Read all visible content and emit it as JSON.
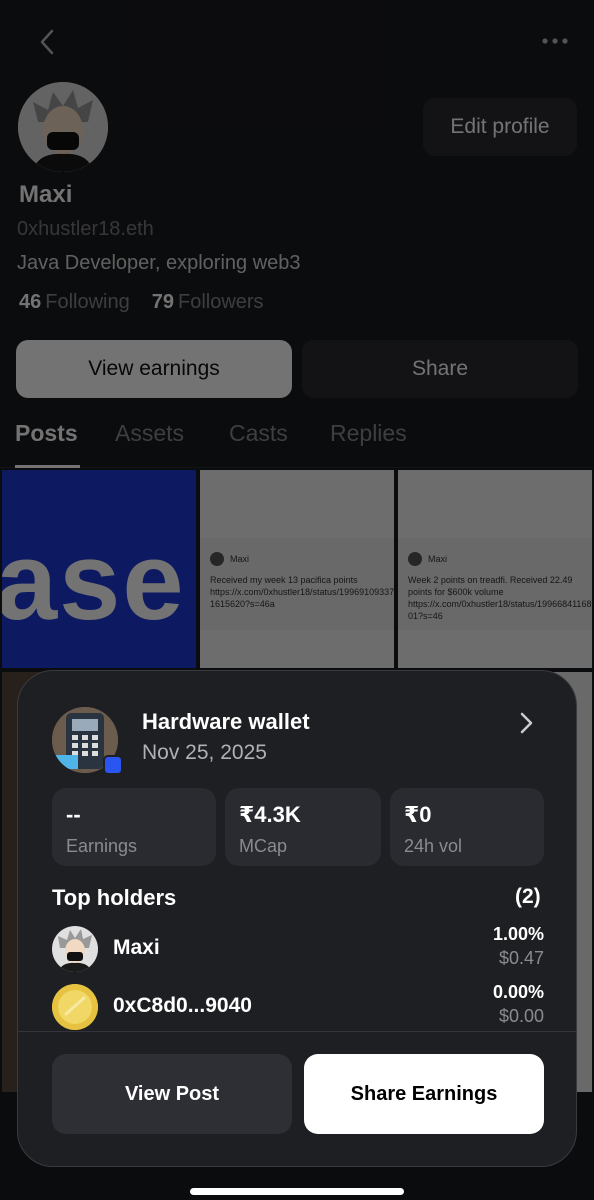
{
  "profile": {
    "name": "Maxi",
    "handle": "0xhustler18.eth",
    "bio": "Java Developer, exploring web3",
    "following_count": "46",
    "following_label": "Following",
    "followers_count": "79",
    "followers_label": "Followers",
    "edit_label": "Edit profile",
    "view_earnings_label": "View earnings",
    "share_label": "Share"
  },
  "tabs": [
    {
      "label": "Posts",
      "active": true
    },
    {
      "label": "Assets"
    },
    {
      "label": "Casts"
    },
    {
      "label": "Replies"
    }
  ],
  "grid": {
    "tile1_text": "ase",
    "tile2": {
      "author": "Maxi",
      "text": "Received my week 13 pacifica points https://x.com/0xhustler18/status/199691093375 1615620?s=46a"
    },
    "tile3": {
      "author": "Maxi",
      "text": "Week 2 points on treadfi. Received 22.49 points for $600k volume https://x.com/0xhustler18/status/19966841168725364​01?s=46"
    }
  },
  "card": {
    "title": "Hardware wallet",
    "date": "Nov 25, 2025",
    "stats": [
      {
        "value": "--",
        "label": "Earnings"
      },
      {
        "value": "₹4.3K",
        "label": "MCap"
      },
      {
        "value": "₹0",
        "label": "24h vol"
      }
    ],
    "holders_title": "Top holders",
    "holders_count": "(2)",
    "holders": [
      {
        "name": "Maxi",
        "percent": "1.00%",
        "usd": "$0.47"
      },
      {
        "name": "0xC8d0...9040",
        "percent": "0.00%",
        "usd": "$0.00"
      }
    ],
    "view_post_label": "View Post",
    "share_earnings_label": "Share Earnings"
  },
  "icons": {
    "back": "chevron-left-icon",
    "more": "more-horizontal-icon",
    "chevron": "chevron-right-icon"
  }
}
